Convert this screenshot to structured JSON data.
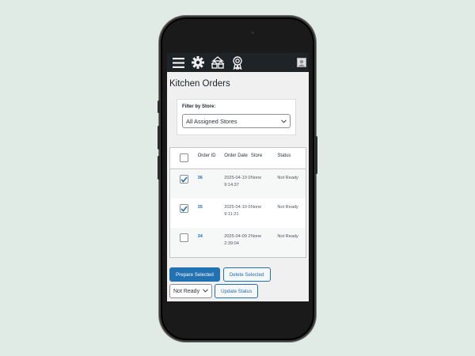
{
  "colors": {
    "accent": "#2271b1",
    "topbar": "#1d2327",
    "background": "#e1ebe6"
  },
  "topbar": {
    "icons": [
      "menu-icon",
      "gear-icon",
      "stores-icon",
      "award-icon",
      "user-avatar-icon"
    ]
  },
  "page": {
    "title": "Kitchen Orders"
  },
  "filter": {
    "label": "Filter by Store:",
    "selected": "All Assigned Stores"
  },
  "table": {
    "headers": {
      "id": "Order ID",
      "date": "Order Date",
      "store": "Store",
      "status": "Status"
    },
    "rows": [
      {
        "checked": true,
        "id": "36",
        "date": "2025-04-10 09:14:37",
        "store": "None",
        "status": "Not Ready"
      },
      {
        "checked": true,
        "id": "35",
        "date": "2025-04-10 09:11:21",
        "store": "None",
        "status": "Not Ready"
      },
      {
        "checked": false,
        "id": "34",
        "date": "2025-04-09 22:39:04",
        "store": "None",
        "status": "Not Ready"
      }
    ]
  },
  "actions": {
    "prepare_label": "Prepare Selected",
    "delete_label": "Delete Selected",
    "status_selected": "Not Ready",
    "update_label": "Update Status"
  }
}
